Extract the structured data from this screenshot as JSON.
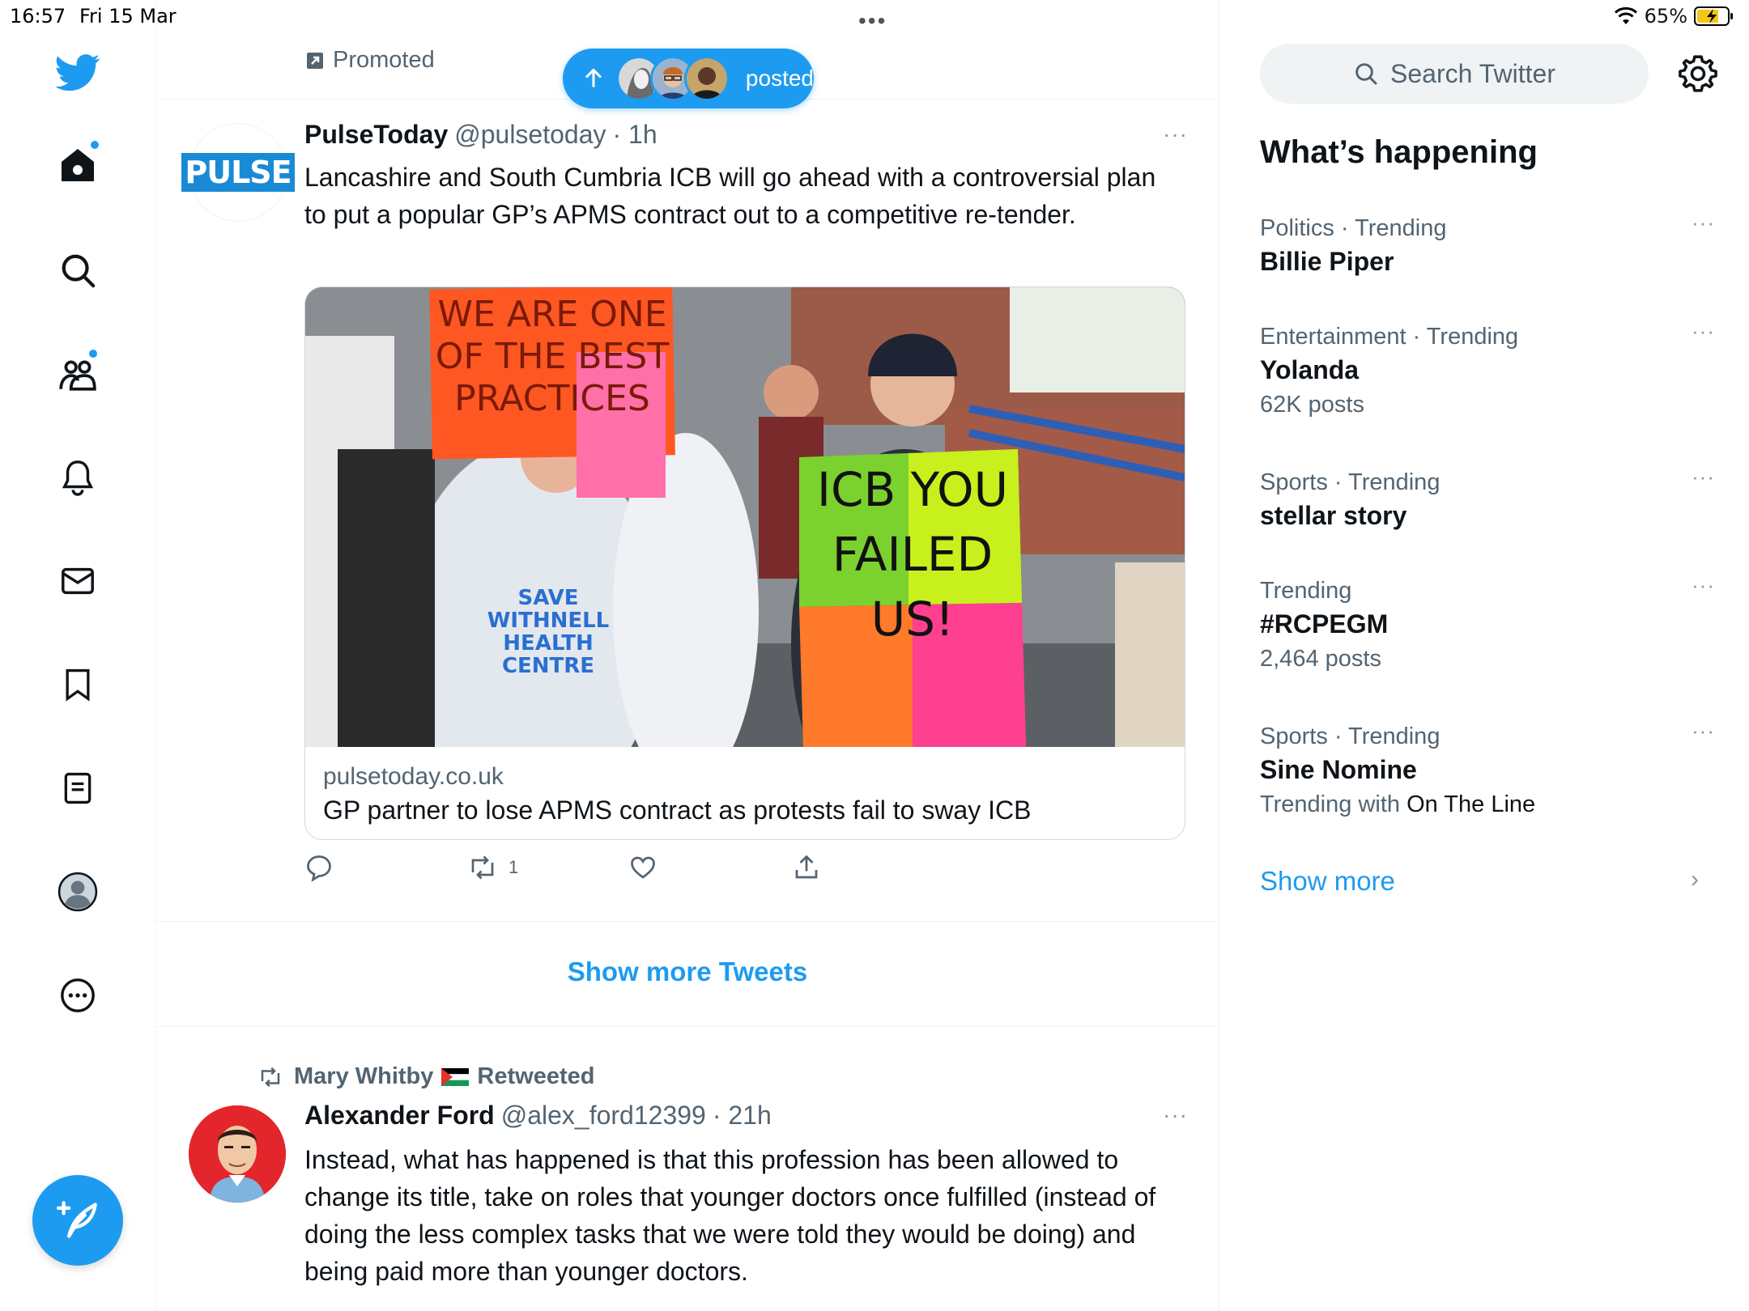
{
  "status_bar": {
    "time": "16:57",
    "date": "Fri 15 Mar",
    "battery": "65%"
  },
  "nav": {
    "items": [
      "home",
      "explore",
      "communities",
      "notifications",
      "messages",
      "bookmarks",
      "lists",
      "profile",
      "more"
    ]
  },
  "promoted_label": "Promoted",
  "new_posts_pill": {
    "label": "posted"
  },
  "tweet1": {
    "name": "PulseToday",
    "handle": "@pulsetoday",
    "time": "· 1h",
    "avatar_text": "PULSE",
    "more": "···",
    "text": "Lancashire and South Cumbria ICB will go ahead with a controversial plan to put a popular GP’s APMS contract out to a competitive re-tender.",
    "card": {
      "domain": "pulsetoday.co.uk",
      "title": "GP partner to lose APMS contract as protests fail to sway ICB",
      "image_signs": {
        "sign1": "WE ARE ONE OF THE BEST PRACTICES",
        "sign2": "ICB YOU FAILED US!",
        "shirt": "SAVE WITHNELL HEALTH CENTRE"
      }
    },
    "retweet_count": "1"
  },
  "show_more_tweets": "Show more Tweets",
  "tweet2": {
    "retweeted_by": "Mary Whitby",
    "retweeted_label": "Retweeted",
    "name": "Alexander Ford",
    "handle": "@alex_ford12399",
    "time": "· 21h",
    "more": "···",
    "text": "Instead, what has happened is that this profession has been allowed to change its title, take on roles that younger doctors once fulfilled (instead of doing the less complex tasks that we were told they would be doing) and being paid more than younger doctors."
  },
  "sidebar": {
    "search_placeholder": "Search Twitter",
    "whats_happening": "What’s happening",
    "trends": [
      {
        "category": "Politics · Trending",
        "name": "Billie Piper",
        "count": ""
      },
      {
        "category": "Entertainment · Trending",
        "name": "Yolanda",
        "count": "62K posts"
      },
      {
        "category": "Sports · Trending",
        "name": "stellar story",
        "count": ""
      },
      {
        "category": "Trending",
        "name": "#RCPEGM",
        "count": "2,464 posts"
      },
      {
        "category": "Sports · Trending",
        "name": "Sine Nomine",
        "count_prefix": "Trending with",
        "count_suffix": "On The Line"
      }
    ],
    "show_more": "Show more",
    "more_dots": "···"
  },
  "colors": {
    "accent": "#1d9bf0",
    "text": "#0f1419",
    "muted": "#536471",
    "border": "#eff3f4"
  }
}
